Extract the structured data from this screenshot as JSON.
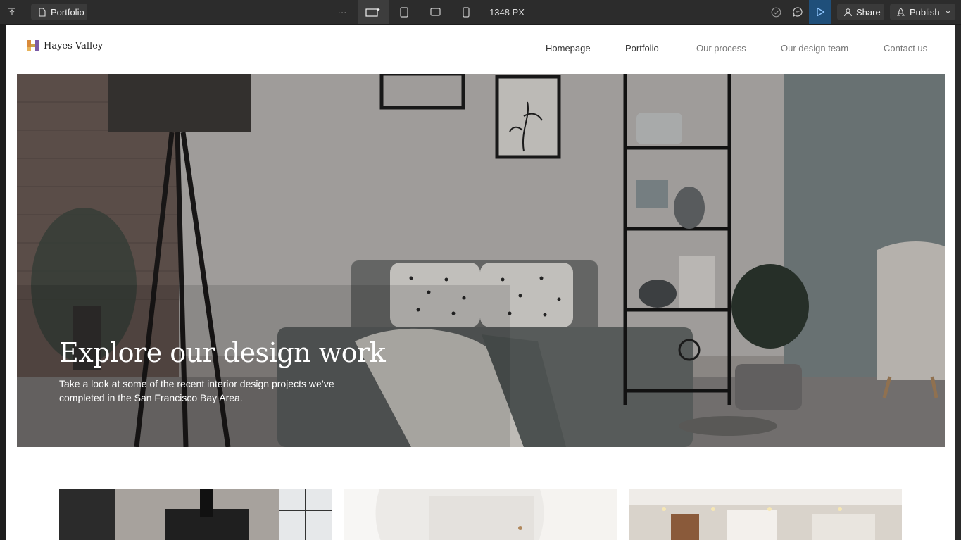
{
  "toolbar": {
    "page_name": "Portfolio",
    "more": "···",
    "width_readout": "1348 PX",
    "share_label": "Share",
    "publish_label": "Publish"
  },
  "site": {
    "logo_text": "Hayes Valley",
    "nav": [
      "Homepage",
      "Portfolio",
      "Our process",
      "Our design team",
      "Contact us"
    ],
    "hero_title": "Explore our design work",
    "hero_subtitle": "Take a look at some of the recent interior design projects we’ve completed in the San Francisco Bay Area."
  },
  "colors": {
    "toolbar_bg": "#2c2c2c",
    "accent_blue": "#1f4f7a",
    "logo_orange": "#d98a3a",
    "logo_purple": "#7a5aa6"
  }
}
